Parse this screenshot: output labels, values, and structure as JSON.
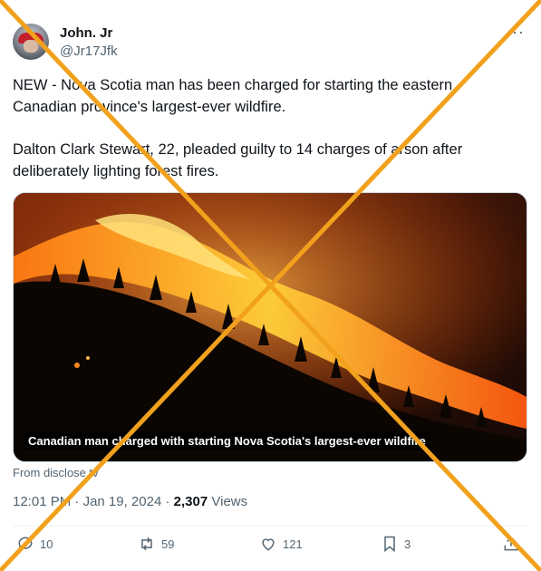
{
  "author": {
    "name": "John. Jr",
    "handle": "@Jr17Jfk"
  },
  "more_label": "···",
  "tweet": {
    "paragraph1": "NEW - Nova Scotia man has been charged for starting the eastern Canadian province's largest-ever wildfire.",
    "paragraph2": "Dalton Clark Stewart, 22, pleaded guilty to 14 charges of arson after deliberately lighting forest fires."
  },
  "media": {
    "caption": "Canadian man charged with starting Nova Scotia's largest-ever wildfire",
    "source": "From disclose.tv"
  },
  "meta": {
    "time": "12:01 PM",
    "separator": " · ",
    "date": "Jan 19, 2024",
    "views_count": "2,307",
    "views_label": "Views"
  },
  "actions": {
    "replies": "10",
    "reposts": "59",
    "likes": "121",
    "bookmarks": "3"
  },
  "icons": [
    "reply-icon",
    "repost-icon",
    "like-icon",
    "bookmark-icon",
    "share-icon",
    "more-icon"
  ],
  "colors": {
    "overlay_cross": "#f2a11d",
    "text_secondary": "#536471"
  }
}
